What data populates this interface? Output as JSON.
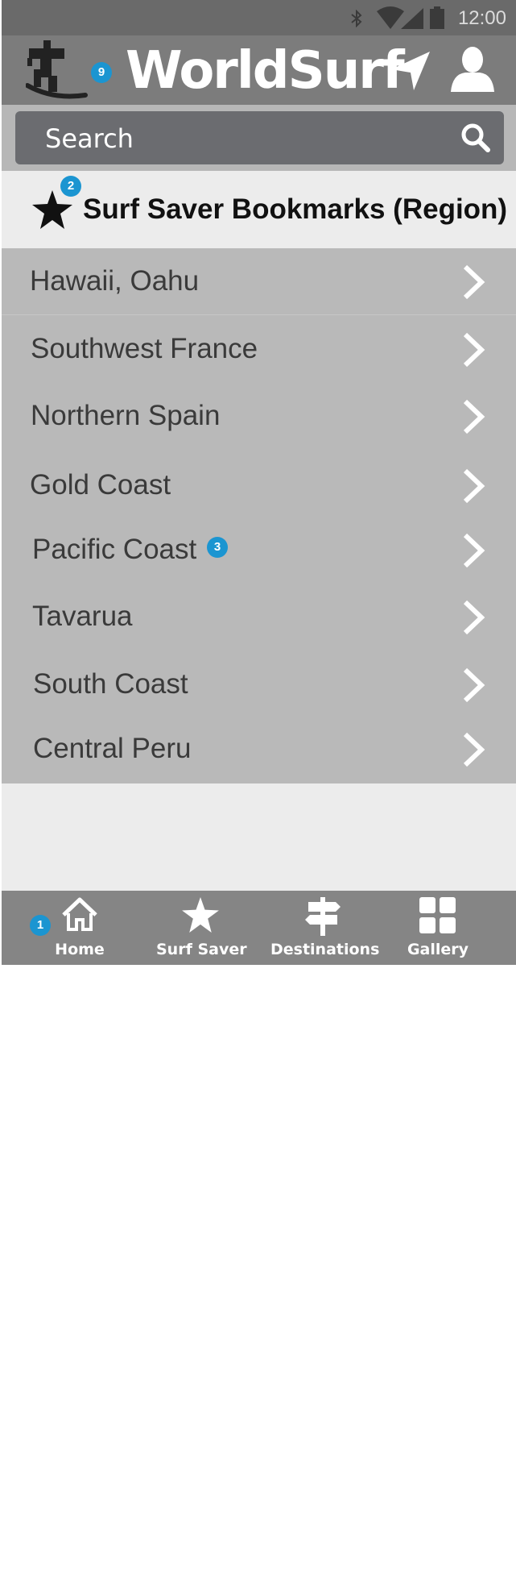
{
  "status_bar": {
    "time": "12:00"
  },
  "app_bar": {
    "title": "WorldSurf",
    "logo_badge": "9"
  },
  "search": {
    "placeholder": "Search"
  },
  "section": {
    "title": "Surf Saver Bookmarks (Region)",
    "badge": "2"
  },
  "regions": [
    {
      "label": "Hawaii, Oahu"
    },
    {
      "label": "Southwest France"
    },
    {
      "label": "Northern Spain"
    },
    {
      "label": "Gold Coast"
    },
    {
      "label": "Pacific Coast",
      "badge": "3"
    },
    {
      "label": "Tavarua"
    },
    {
      "label": "South Coast"
    },
    {
      "label": "Central Peru"
    }
  ],
  "bottom_nav": {
    "home_badge": "1",
    "items": [
      {
        "label": "Home",
        "icon": "home-icon"
      },
      {
        "label": "Surf Saver",
        "icon": "star-icon"
      },
      {
        "label": "Destinations",
        "icon": "signpost-icon"
      },
      {
        "label": "Gallery",
        "icon": "grid-icon"
      }
    ]
  },
  "colors": {
    "badge": "#1b95d1",
    "app_bar": "#7c7c7c",
    "list_background": "#b9b9b9",
    "text_dark": "#3a3a3a"
  }
}
